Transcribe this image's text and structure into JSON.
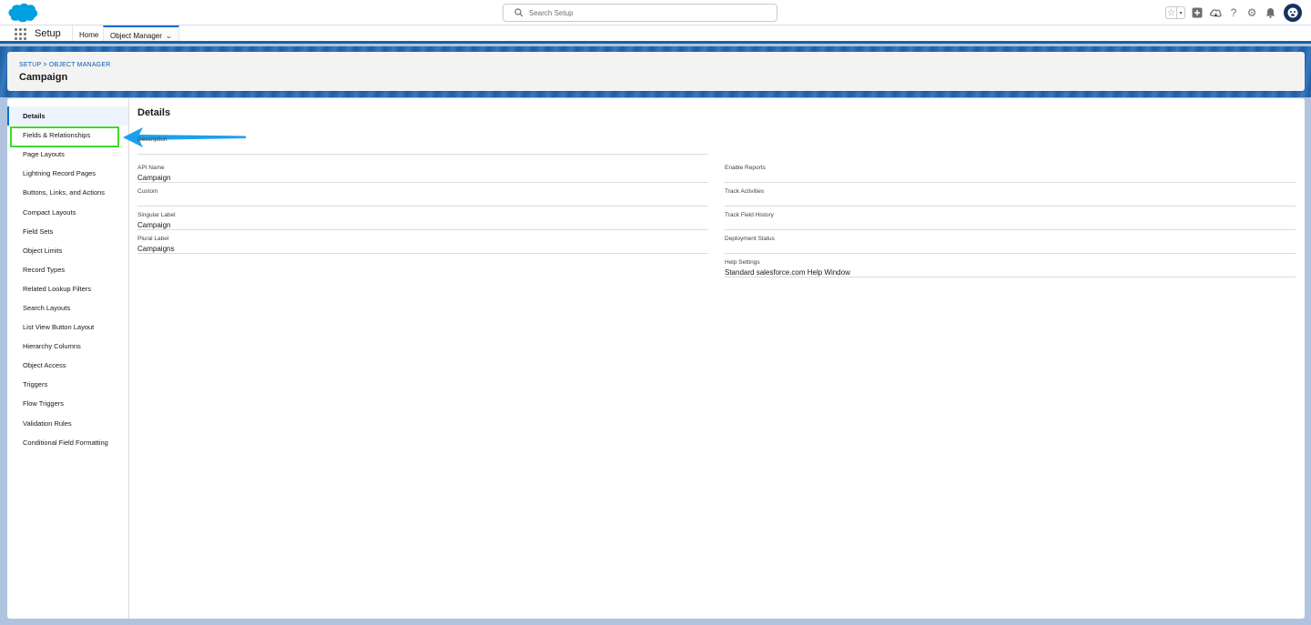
{
  "header": {
    "search_placeholder": "Search Setup",
    "icons": [
      "star-icon",
      "add-icon",
      "trailhead-icon",
      "help-icon",
      "gear-icon",
      "bell-icon",
      "avatar"
    ]
  },
  "app_nav": {
    "app_name": "Setup",
    "tabs": [
      {
        "label": "Home"
      },
      {
        "label": "Object Manager",
        "active": true
      }
    ]
  },
  "page_header": {
    "breadcrumb": [
      "SETUP",
      "OBJECT MANAGER"
    ],
    "breadcrumb_separator": ">",
    "title": "Campaign"
  },
  "sidebar": {
    "items": [
      {
        "label": "Details",
        "active": true
      },
      {
        "label": "Fields & Relationships",
        "highlighted": true
      },
      {
        "label": "Page Layouts"
      },
      {
        "label": "Lightning Record Pages"
      },
      {
        "label": "Buttons, Links, and Actions"
      },
      {
        "label": "Compact Layouts"
      },
      {
        "label": "Field Sets"
      },
      {
        "label": "Object Limits"
      },
      {
        "label": "Record Types"
      },
      {
        "label": "Related Lookup Filters"
      },
      {
        "label": "Search Layouts"
      },
      {
        "label": "List View Button Layout"
      },
      {
        "label": "Hierarchy Columns"
      },
      {
        "label": "Object Access"
      },
      {
        "label": "Triggers"
      },
      {
        "label": "Flow Triggers"
      },
      {
        "label": "Validation Rules"
      },
      {
        "label": "Conditional Field Formatting"
      }
    ]
  },
  "details": {
    "title": "Details",
    "description_label": "Description",
    "left_fields": [
      {
        "label": "API Name",
        "value": "Campaign"
      },
      {
        "label": "Custom",
        "value": ""
      },
      {
        "label": "Singular Label",
        "value": "Campaign"
      },
      {
        "label": "Plural Label",
        "value": "Campaigns"
      }
    ],
    "right_fields": [
      {
        "label": "Enable Reports",
        "value": ""
      },
      {
        "label": "Track Activities",
        "value": ""
      },
      {
        "label": "Track Field History",
        "value": ""
      },
      {
        "label": "Deployment Status",
        "value": ""
      },
      {
        "label": "Help Settings",
        "value": "Standard salesforce.com Help Window"
      }
    ]
  },
  "colors": {
    "brand": "#0070d2",
    "highlight_box": "#3ddc2a",
    "arrow": "#1aa0f0"
  }
}
